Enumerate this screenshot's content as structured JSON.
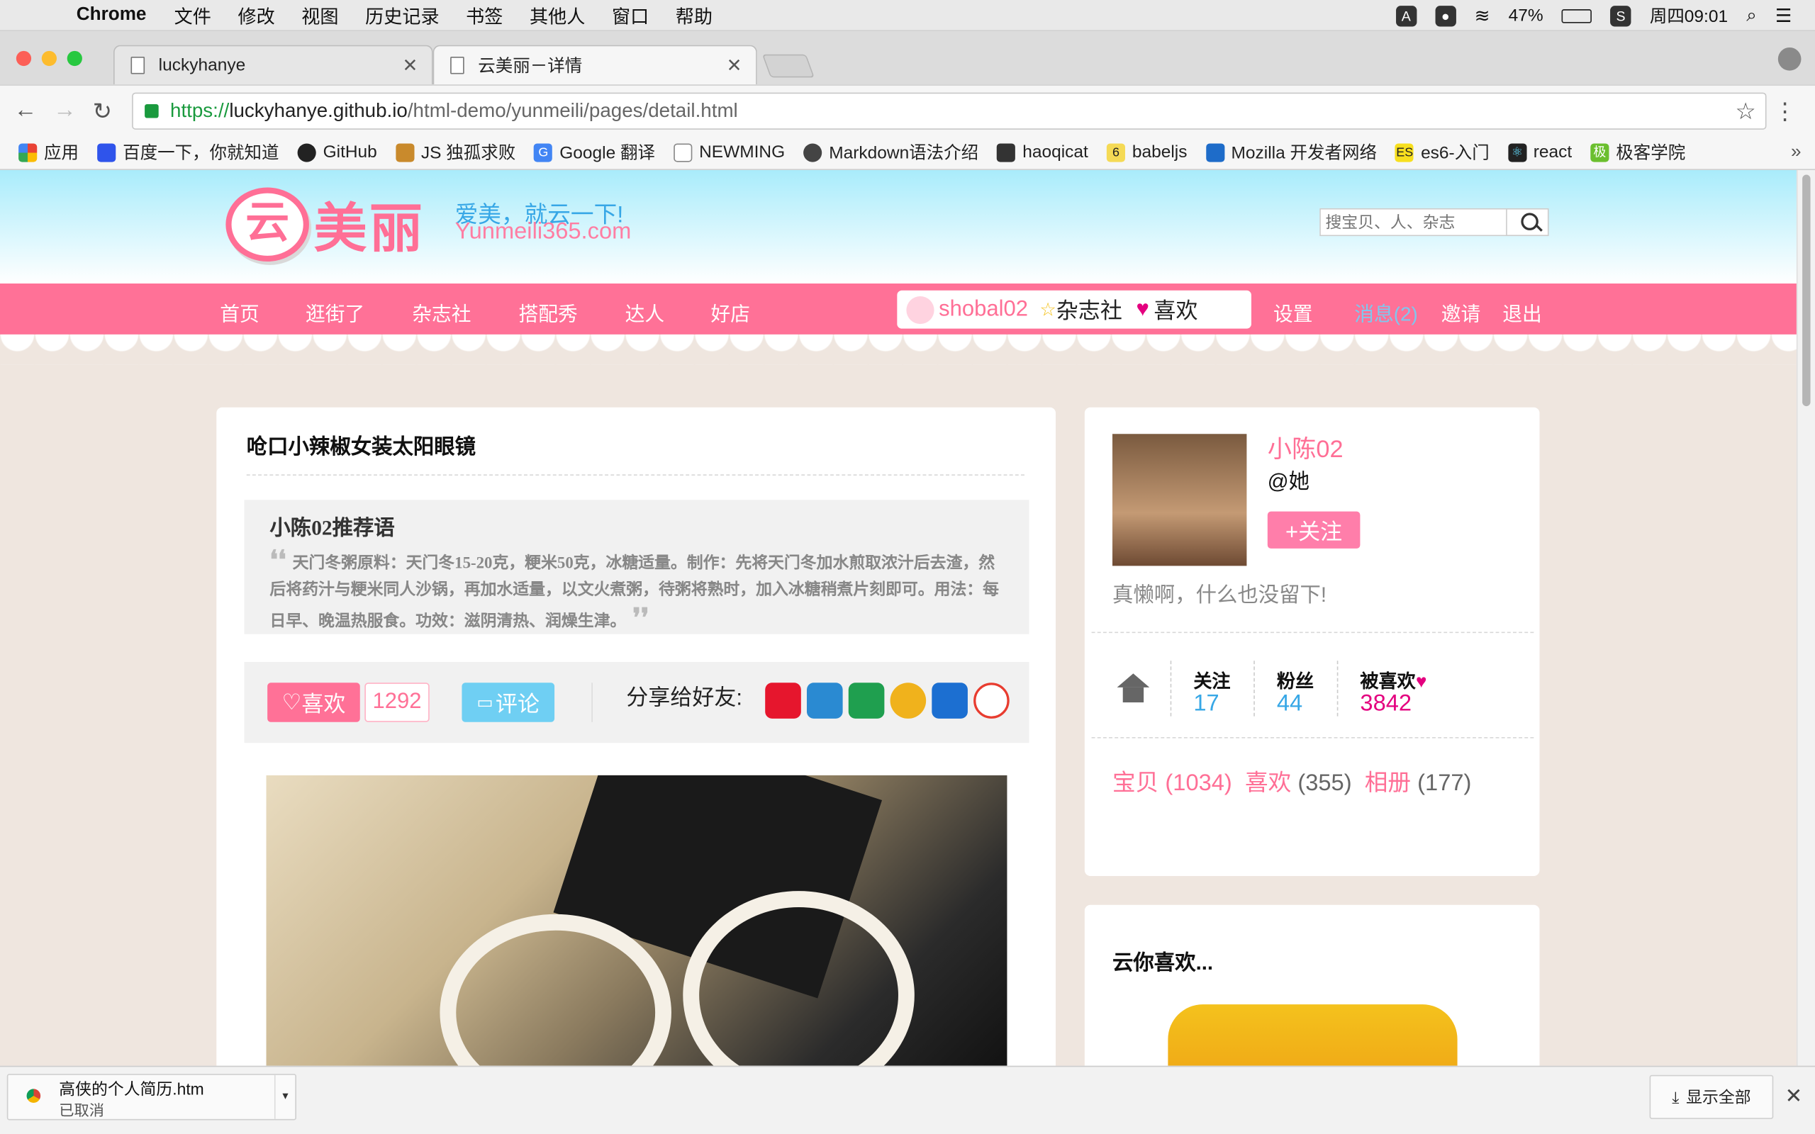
{
  "menubar": {
    "apple_icon": "apple-icon",
    "items": [
      "Chrome",
      "文件",
      "修改",
      "视图",
      "历史记录",
      "书签",
      "其他人",
      "窗口",
      "帮助"
    ],
    "battery": "47%",
    "clock": "周四09:01"
  },
  "browser": {
    "tabs": [
      {
        "title": "luckyhanye"
      },
      {
        "title": "云美丽－详情"
      }
    ],
    "url": {
      "scheme": "https://",
      "host": "luckyhanye.github.io",
      "path": "/html-demo/yunmeili/pages/detail.html"
    },
    "bookmarks": [
      "应用",
      "百度一下，你就知道",
      "GitHub",
      "JS 独孤求败",
      "Google 翻译",
      "NEWMING",
      "Markdown语法介绍",
      "haoqicat",
      "babeljs",
      "Mozilla 开发者网络",
      "es6-入门",
      "react",
      "极客学院"
    ],
    "bookmarks_more": "»"
  },
  "site": {
    "logo": {
      "badge": "云",
      "text": "美丽"
    },
    "slogan": "爱美，就云一下!",
    "slogan_en": "Yunmeili365.com",
    "search_placeholder": "搜宝贝、人、杂志",
    "nav": [
      "首页",
      "逛街了",
      "杂志社",
      "搭配秀",
      "达人",
      "好店"
    ],
    "user": {
      "name": "shobal02",
      "magazine": "杂志社",
      "likes": "喜欢"
    },
    "right_nav": {
      "settings": "设置",
      "messages": "消息(2)",
      "invite": "邀请",
      "logout": "退出"
    },
    "colors": {
      "brand_pink": "#ff7197",
      "sky_blue": "#37a7e6"
    }
  },
  "detail": {
    "title": "呛口小辣椒女装太阳眼镜",
    "rec_title": "小陈02推荐语",
    "rec_text": "天门冬粥原料：天门冬15-20克，粳米50克，冰糖适量。制作：先将天门冬加水煎取浓汁后去渣，然后将药汁与粳米同人沙锅，再加水适量，以文火煮粥，待粥将熟时，加入冰糖稍煮片刻即可。用法：每日早、晚温热服食。功效：滋阴清热、润燥生津。",
    "like_label": "喜欢",
    "like_count": "1292",
    "comment_label": "评论",
    "share_label": "分享给好友:"
  },
  "profile": {
    "name": "小陈02",
    "handle": "@她",
    "follow_label": "+关注",
    "bio": "真懒啊，什么也没留下!",
    "stats": [
      {
        "label": "关注",
        "value": "17"
      },
      {
        "label": "粉丝",
        "value": "44"
      },
      {
        "label": "被喜欢",
        "value": "3842"
      }
    ],
    "counts": [
      {
        "label": "宝贝",
        "value": "(1034)"
      },
      {
        "label": "喜欢",
        "value": "(355)"
      },
      {
        "label": "相册",
        "value": "(177)"
      }
    ]
  },
  "recommend": {
    "title": "云你喜欢..."
  },
  "downloads": {
    "file": "高侠的个人简历.htm",
    "status": "已取消",
    "show_all": "显示全部"
  }
}
